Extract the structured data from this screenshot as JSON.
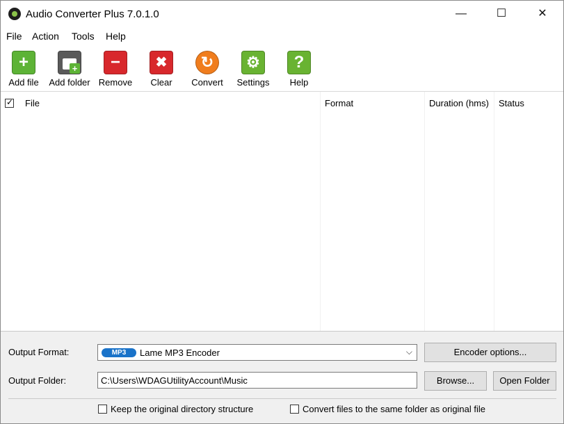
{
  "window": {
    "title": "Audio Converter Plus 7.0.1.0"
  },
  "window_controls": {
    "minimize": "—",
    "maximize": "☐",
    "close": "✕"
  },
  "menu": [
    "File",
    "Action",
    "Tools",
    "Help"
  ],
  "toolbar": [
    {
      "label": "Add file",
      "icon": "add-file-icon",
      "color": "#5db336"
    },
    {
      "label": "Add folder",
      "icon": "add-folder-icon",
      "color": "#6a6a6a"
    },
    {
      "label": "Remove",
      "icon": "remove-icon",
      "color": "#d8282c"
    },
    {
      "label": "Clear",
      "icon": "clear-icon",
      "color": "#d8282c"
    },
    {
      "label": "Convert",
      "icon": "convert-icon",
      "color": "#f07d1d"
    },
    {
      "label": "Settings",
      "icon": "settings-icon",
      "color": "#69b332"
    },
    {
      "label": "Help",
      "icon": "help-icon",
      "color": "#69b332"
    }
  ],
  "file_list": {
    "columns": [
      "File",
      "Format",
      "Duration (hms)",
      "Status"
    ],
    "select_all_checked": true,
    "rows": []
  },
  "output": {
    "format_label": "Output Format:",
    "format_badge": "MP3",
    "format_value": "Lame MP3 Encoder",
    "encoder_options": "Encoder options...",
    "folder_label": "Output Folder:",
    "folder_value": "C:\\Users\\WDAGUtilityAccount\\Music",
    "browse": "Browse...",
    "open_folder": "Open Folder"
  },
  "options": {
    "keep_structure": "Keep the original directory structure",
    "keep_structure_checked": false,
    "same_folder": "Convert files to the same folder as original file",
    "same_folder_checked": false
  },
  "colors": {
    "accent": "#1a73c9"
  }
}
